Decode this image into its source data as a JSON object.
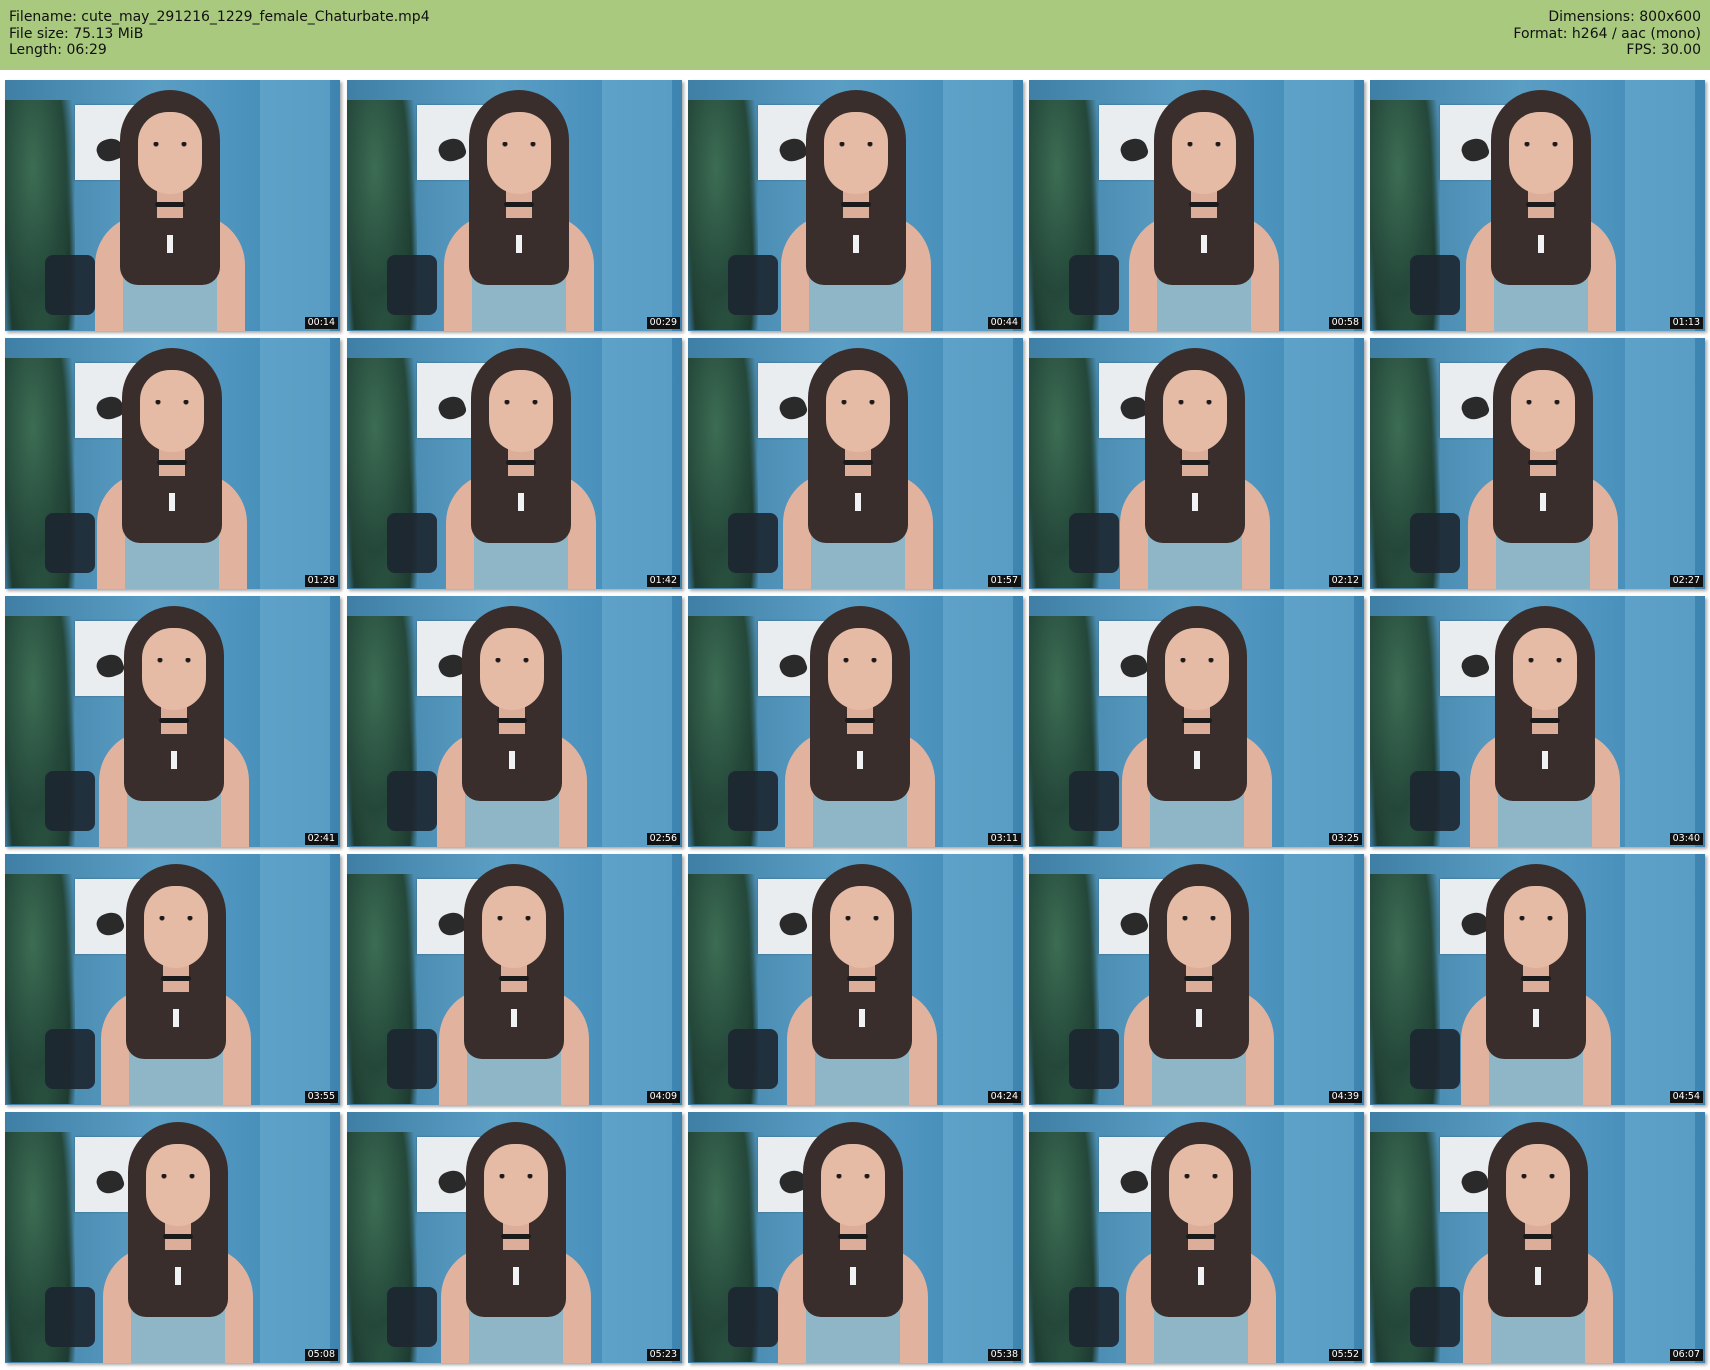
{
  "header": {
    "filename": "Filename: cute_may_291216_1229_female_Chaturbate.mp4",
    "filesize": "File size: 75.13 MiB",
    "length": "Length: 06:29",
    "dimensions": "Dimensions: 800x600",
    "format": "Format: h264 / aac (mono)",
    "fps": "FPS: 30.00",
    "background_color": "#a9c97e"
  },
  "grid": {
    "columns": 5,
    "rows": 5,
    "timestamps": [
      "00:14",
      "00:29",
      "00:44",
      "00:58",
      "01:13",
      "01:28",
      "01:42",
      "01:57",
      "02:12",
      "02:27",
      "02:41",
      "02:56",
      "03:11",
      "03:25",
      "03:40",
      "03:55",
      "04:09",
      "04:24",
      "04:39",
      "04:54",
      "05:08",
      "05:23",
      "05:38",
      "05:52",
      "06:07"
    ]
  }
}
